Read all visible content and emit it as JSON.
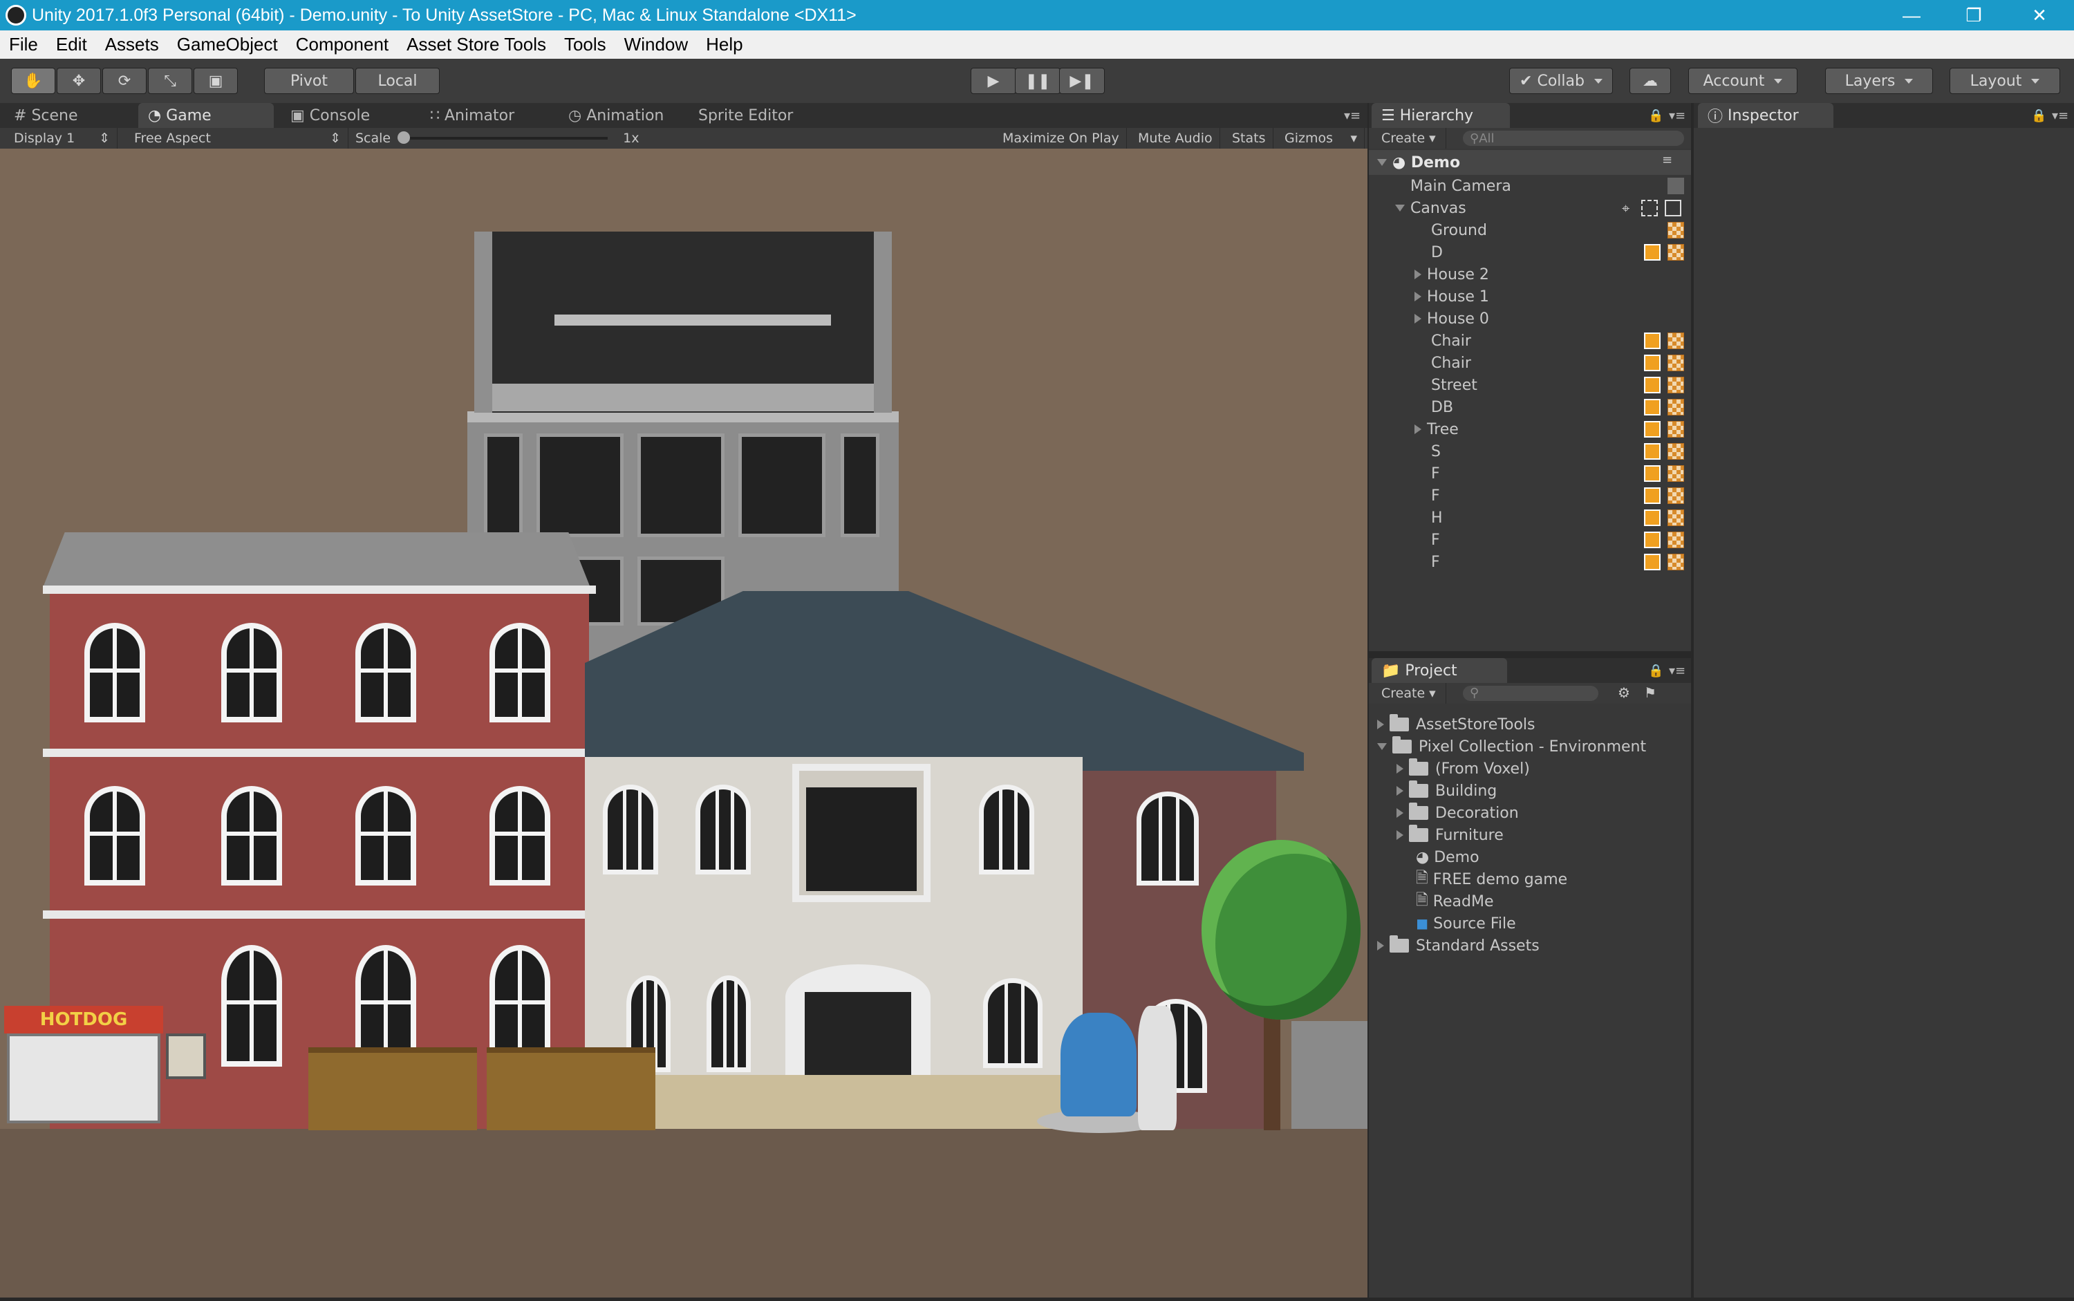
{
  "window": {
    "title": "Unity 2017.1.0f3 Personal (64bit) - Demo.unity - To Unity AssetStore - PC, Mac & Linux Standalone <DX11>"
  },
  "menu": [
    "File",
    "Edit",
    "Assets",
    "GameObject",
    "Component",
    "Asset Store Tools",
    "Tools",
    "Window",
    "Help"
  ],
  "toolbar": {
    "pivot": "Pivot",
    "local": "Local",
    "collab": "Collab",
    "account": "Account",
    "layers": "Layers",
    "layout": "Layout"
  },
  "tabs": [
    "Scene",
    "Game",
    "Console",
    "Animator",
    "Animation",
    "Sprite Editor"
  ],
  "game_bar": {
    "display": "Display 1",
    "aspect": "Free Aspect",
    "scale_label": "Scale",
    "scale_value": "1x",
    "maximize": "Maximize On Play",
    "mute": "Mute Audio",
    "stats": "Stats",
    "gizmos": "Gizmos"
  },
  "scene_art": {
    "cart_sign": "HOTDOG"
  },
  "hierarchy": {
    "title": "Hierarchy",
    "create": "Create",
    "search_placeholder": "All",
    "scene": "Demo",
    "items": [
      "Main Camera",
      "Canvas",
      "Ground",
      "D",
      "House 2",
      "House 1",
      "House 0",
      "Chair",
      "Chair",
      "Street",
      "DB",
      "Tree",
      "S",
      "F",
      "F",
      "H",
      "F",
      "F"
    ]
  },
  "project": {
    "title": "Project",
    "create": "Create",
    "items": [
      "AssetStoreTools",
      "Pixel Collection - Environment",
      "(From Voxel)",
      "Building",
      "Decoration",
      "Furniture",
      "Demo",
      "FREE demo game",
      "ReadMe",
      "Source File",
      "Standard Assets"
    ]
  },
  "inspector": {
    "title": "Inspector"
  },
  "colors": {
    "titlebar": "#1a9ac9",
    "game_bg": "#7b6857",
    "panel": "#383838",
    "highlight": "#f0a020"
  }
}
